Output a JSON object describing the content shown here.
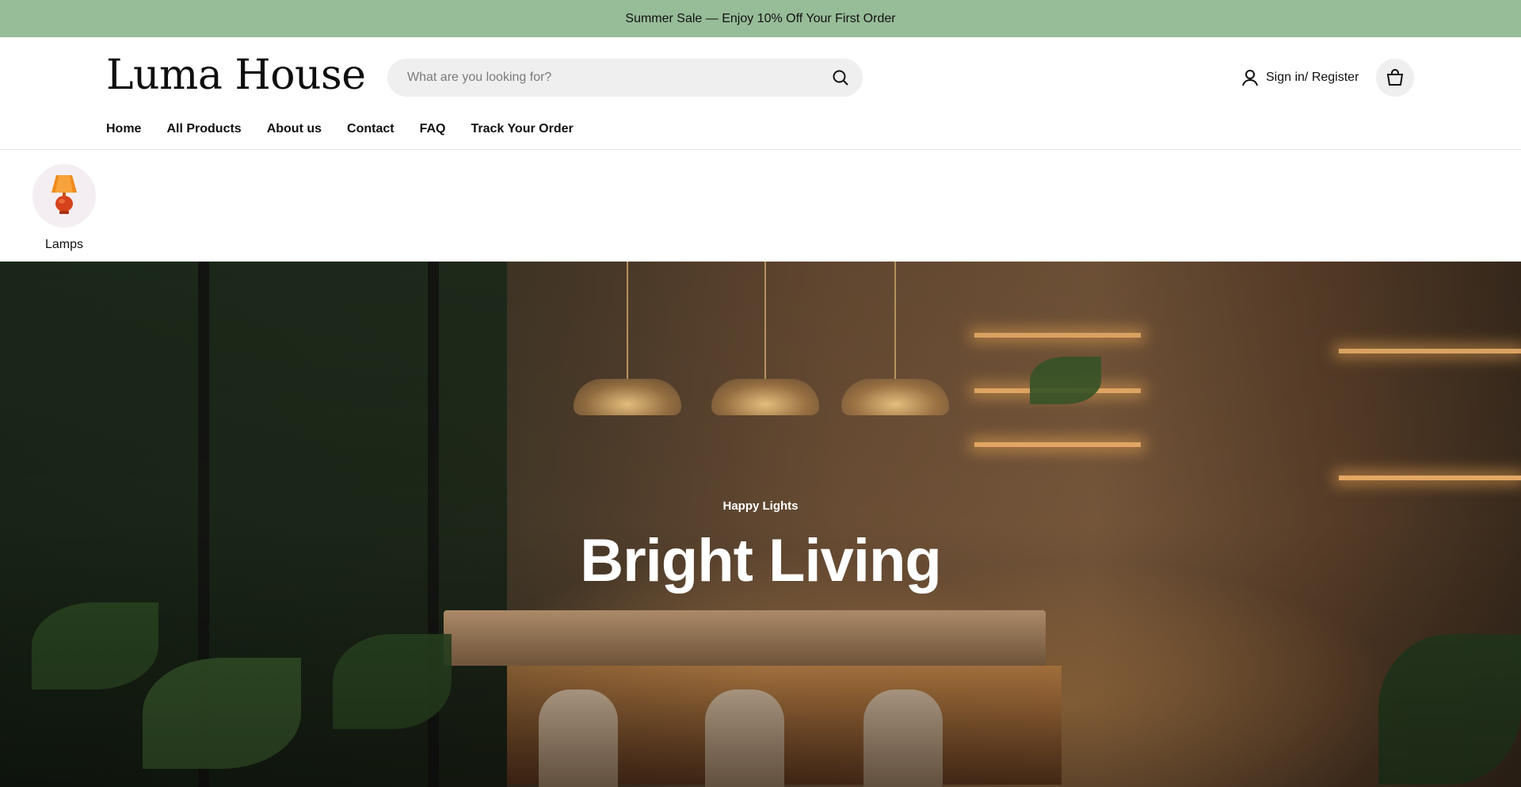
{
  "announcement": {
    "text": "Summer Sale — Enjoy 10% Off Your First Order"
  },
  "header": {
    "logo": "Luma House",
    "search": {
      "placeholder": "What are you looking for?",
      "icon": "search-icon"
    },
    "account": {
      "label": "Sign in/ Register",
      "icon": "user-icon"
    },
    "cart": {
      "icon": "shopping-bag-icon"
    }
  },
  "nav": {
    "items": [
      {
        "label": "Home"
      },
      {
        "label": "All Products"
      },
      {
        "label": "About us"
      },
      {
        "label": "Contact"
      },
      {
        "label": "FAQ"
      },
      {
        "label": "Track Your Order"
      }
    ]
  },
  "categories": [
    {
      "label": "Lamps",
      "icon": "table-lamp-icon"
    }
  ],
  "hero": {
    "kicker": "Happy Lights",
    "title": "Bright Living",
    "colors": {
      "announcement_bg": "#97bc98",
      "search_bg": "#efefef"
    }
  }
}
